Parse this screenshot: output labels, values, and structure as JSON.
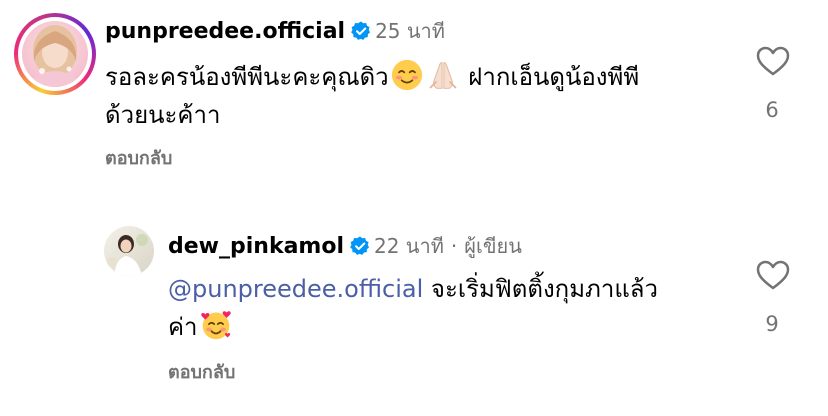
{
  "comments": [
    {
      "username": "punpreedee.official",
      "time": "25 นาที",
      "text_line1": "รอละครน้องพีพีนะคะคุณดิว",
      "text_line1_tail": "ฝากเอ็นดูน้องพีพี",
      "text_line2": "ด้วยนะค้าา",
      "reply_label": "ตอบกลับ",
      "likes": "6",
      "verified": true,
      "emojis": [
        "relieved-face-emoji",
        "folded-hands-emoji"
      ]
    },
    {
      "username": "dew_pinkamol",
      "time": "22 นาที",
      "separator": "·",
      "author_tag": "ผู้เขียน",
      "mention": "@punpreedee.official",
      "text_line1": "จะเริ่มฟิตติ้งกุมภาแล้ว",
      "text_line2": "ค่า",
      "reply_label": "ตอบกลับ",
      "likes": "9",
      "verified": true,
      "emojis": [
        "smiling-face-with-hearts-emoji"
      ]
    }
  ],
  "colors": {
    "verified_badge": "#0095f6",
    "secondary_text": "#737373",
    "mention": "#4a5fa8"
  }
}
